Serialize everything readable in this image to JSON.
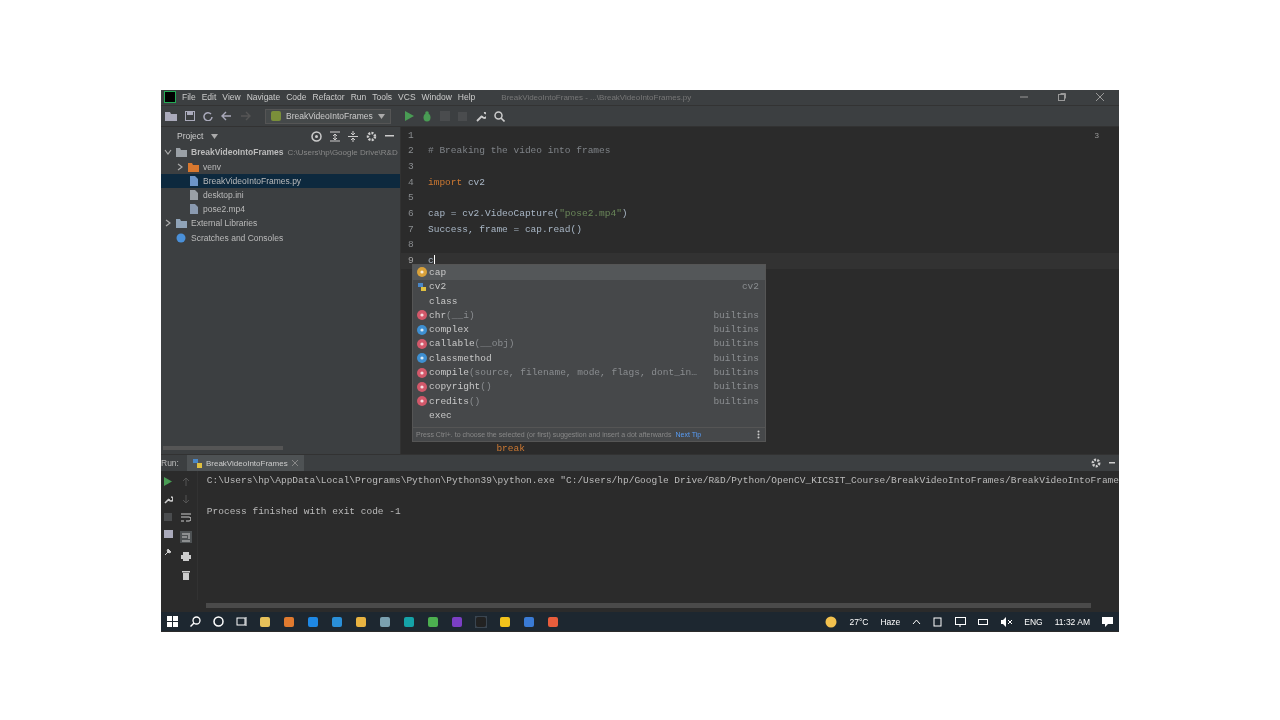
{
  "window": {
    "menu": [
      "File",
      "Edit",
      "View",
      "Navigate",
      "Code",
      "Refactor",
      "Run",
      "Tools",
      "VCS",
      "Window",
      "Help"
    ],
    "title": "BreakVideoIntoFrames - ...\\BreakVideoIntoFrames.py"
  },
  "toolbar": {
    "run_config": "BreakVideoIntoFrames"
  },
  "project": {
    "title": "Project",
    "tree": [
      {
        "label": "BreakVideoIntoFrames",
        "path": "C:\\Users\\hp\\Google Drive\\R&D",
        "kind": "project",
        "expanded": true,
        "selected": false,
        "children": [
          {
            "label": "venv",
            "kind": "folder",
            "expanded": false,
            "selected": false
          },
          {
            "label": "BreakVideoIntoFrames.py",
            "kind": "python",
            "selected": true
          },
          {
            "label": "desktop.ini",
            "kind": "file",
            "selected": false
          },
          {
            "label": "pose2.mp4",
            "kind": "media",
            "selected": false
          }
        ]
      },
      {
        "label": "External Libraries",
        "kind": "library",
        "expanded": false,
        "selected": false
      },
      {
        "label": "Scratches and Consoles",
        "kind": "scratch",
        "selected": false
      }
    ]
  },
  "editor": {
    "warnings": "3",
    "lines": [
      {
        "number": "1",
        "current": false
      },
      {
        "number": "2",
        "current": false,
        "tokens": [
          {
            "kind": "comment",
            "text": "# Breaking the video into frames"
          }
        ]
      },
      {
        "number": "3",
        "current": false
      },
      {
        "number": "4",
        "current": false,
        "tokens": [
          {
            "kind": "keyword",
            "text": "import"
          },
          {
            "kind": "plain",
            "text": " cv2"
          }
        ]
      },
      {
        "number": "5",
        "current": false
      },
      {
        "number": "6",
        "current": false,
        "tokens": [
          {
            "kind": "plain",
            "text": "cap = cv2.VideoCapture("
          },
          {
            "kind": "string",
            "text": "\"pose2.mp4\""
          },
          {
            "kind": "plain",
            "text": ")"
          }
        ]
      },
      {
        "number": "7",
        "current": false,
        "tokens": [
          {
            "kind": "plain",
            "text": "Success, frame = cap.read()"
          }
        ]
      },
      {
        "number": "8",
        "current": false
      },
      {
        "number": "9",
        "current": true,
        "tokens": [
          {
            "kind": "plain",
            "text": "c"
          }
        ]
      },
      {
        "current": false,
        "tokens": [
          {
            "kind": "keyword",
            "text": "            break"
          }
        ]
      }
    ],
    "completion": {
      "items": [
        {
          "kind": "variable",
          "name": "cap",
          "selected": true
        },
        {
          "kind": "module",
          "name": "cv2",
          "source": "cv2",
          "selected": false
        },
        {
          "kind": "keyword",
          "name": "class",
          "selected": false
        },
        {
          "kind": "function",
          "name": "chr",
          "params": "(__i)",
          "source": "builtins",
          "selected": false
        },
        {
          "kind": "class",
          "name": "complex",
          "source": "builtins",
          "selected": false
        },
        {
          "kind": "function",
          "name": "callable",
          "params": "(__obj)",
          "source": "builtins",
          "selected": false
        },
        {
          "kind": "class",
          "name": "classmethod",
          "source": "builtins",
          "selected": false
        },
        {
          "kind": "function",
          "name": "compile",
          "params": "(source, filename, mode, flags, dont_in…",
          "source": "builtins",
          "selected": false
        },
        {
          "kind": "function",
          "name": "copyright",
          "params": "()",
          "source": "builtins",
          "selected": false
        },
        {
          "kind": "function",
          "name": "credits",
          "params": "()",
          "source": "builtins",
          "selected": false
        },
        {
          "kind": "keyword",
          "name": "exec",
          "selected": false
        }
      ],
      "hint": "Press Ctrl+. to choose the selected (or first) suggestion and insert a dot afterwards",
      "link": "Next Tip"
    }
  },
  "run": {
    "label": "Run:",
    "tab": "BreakVideoIntoFrames",
    "output": [
      "C:\\Users\\hp\\AppData\\Local\\Programs\\Python\\Python39\\python.exe \"C:/Users/hp/Google Drive/R&D/Python/OpenCV_KICSIT_Course/BreakVideoIntoFrames/BreakVideoIntoFrame",
      "Process finished with exit code -1"
    ]
  },
  "taskbar": {
    "weather": "27°C",
    "condition": "Haze",
    "language": "ENG",
    "time": "11:32 AM"
  }
}
